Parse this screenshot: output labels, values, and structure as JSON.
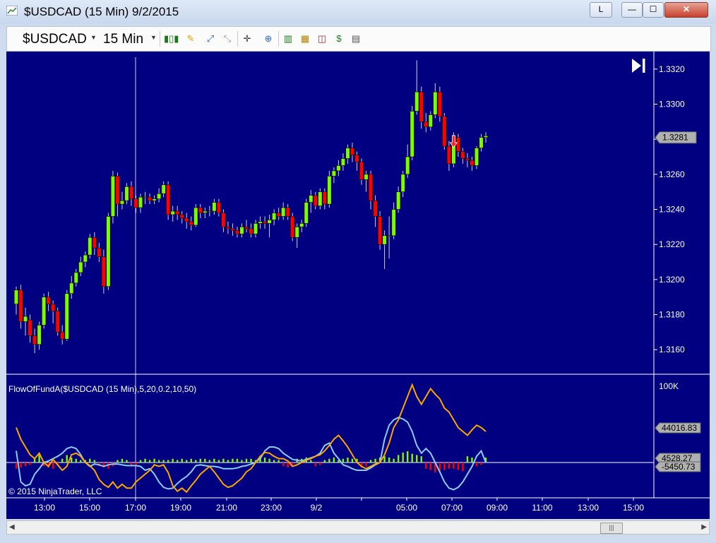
{
  "window": {
    "title": "$USDCAD (15 Min)  9/2/2015",
    "buttons": {
      "link": "L",
      "minimize": "—",
      "maximize": "☐",
      "close": "✕"
    }
  },
  "toolbar": {
    "instrument": "$USDCAD",
    "interval": "15 Min",
    "icons": [
      "bars-icon",
      "pencil-icon",
      "zoom-in-icon",
      "zoom-out-icon",
      "crosshair-icon",
      "zoom-icon",
      "data-box-icon",
      "chart-style-icon",
      "indicators-icon",
      "strategies-icon",
      "properties-icon"
    ]
  },
  "chart_data": {
    "type": "candlestick",
    "colors": {
      "background": "#000080",
      "up": "#7cfc00",
      "down": "#ff0000",
      "axis_text": "#ffffff"
    },
    "price_panel": {
      "y_ticks": [
        "1.3320",
        "1.3300",
        "1.3280",
        "1.3260",
        "1.3240",
        "1.3220",
        "1.3200",
        "1.3180",
        "1.3160"
      ],
      "ylim": [
        1.3146,
        1.333
      ],
      "last_price_label": "1.3281",
      "signal_arrow": {
        "bar": 95,
        "direction": "down"
      },
      "candles": [
        [
          1.3186,
          1.3196,
          1.318,
          1.3194
        ],
        [
          1.3194,
          1.3197,
          1.3172,
          1.3176
        ],
        [
          1.3176,
          1.3184,
          1.3168,
          1.3179
        ],
        [
          1.3177,
          1.318,
          1.3164,
          1.3168
        ],
        [
          1.3168,
          1.3172,
          1.3158,
          1.3163
        ],
        [
          1.3163,
          1.3176,
          1.316,
          1.3174
        ],
        [
          1.3174,
          1.3192,
          1.3172,
          1.319
        ],
        [
          1.319,
          1.3193,
          1.3182,
          1.3186
        ],
        [
          1.3186,
          1.3188,
          1.3175,
          1.3182
        ],
        [
          1.3182,
          1.3184,
          1.3168,
          1.317
        ],
        [
          1.317,
          1.3174,
          1.3163,
          1.3166
        ],
        [
          1.3166,
          1.3194,
          1.3165,
          1.3192
        ],
        [
          1.3192,
          1.3202,
          1.3189,
          1.3198
        ],
        [
          1.3198,
          1.3206,
          1.3196,
          1.3204
        ],
        [
          1.3204,
          1.3213,
          1.3202,
          1.321
        ],
        [
          1.321,
          1.3216,
          1.3207,
          1.3214
        ],
        [
          1.3214,
          1.3226,
          1.3212,
          1.3224
        ],
        [
          1.3224,
          1.3227,
          1.3214,
          1.3218
        ],
        [
          1.3218,
          1.3221,
          1.321,
          1.3213
        ],
        [
          1.3213,
          1.3217,
          1.3192,
          1.3196
        ],
        [
          1.3196,
          1.3238,
          1.3194,
          1.3236
        ],
        [
          1.3236,
          1.3262,
          1.3232,
          1.3259
        ],
        [
          1.3259,
          1.3261,
          1.3236,
          1.3243
        ],
        [
          1.3243,
          1.325,
          1.324,
          1.3245
        ],
        [
          1.3245,
          1.3255,
          1.3243,
          1.3253
        ],
        [
          1.3253,
          1.3256,
          1.3242,
          1.3246
        ],
        [
          1.3246,
          1.3248,
          1.3238,
          1.3241
        ],
        [
          1.3241,
          1.3249,
          1.3238,
          1.3247
        ],
        [
          1.3247,
          1.325,
          1.3243,
          1.3247
        ],
        [
          1.3247,
          1.3249,
          1.3243,
          1.3245
        ],
        [
          1.3245,
          1.3248,
          1.3243,
          1.3246
        ],
        [
          1.3246,
          1.3252,
          1.3244,
          1.3249
        ],
        [
          1.3249,
          1.3256,
          1.3247,
          1.3254
        ],
        [
          1.3254,
          1.3256,
          1.3234,
          1.3237
        ],
        [
          1.3237,
          1.3242,
          1.3233,
          1.3239
        ],
        [
          1.3239,
          1.3242,
          1.3234,
          1.3237
        ],
        [
          1.3237,
          1.3239,
          1.3232,
          1.3235
        ],
        [
          1.3235,
          1.3238,
          1.3229,
          1.3233
        ],
        [
          1.3233,
          1.3236,
          1.3228,
          1.3231
        ],
        [
          1.3231,
          1.3243,
          1.323,
          1.3241
        ],
        [
          1.3241,
          1.3243,
          1.3235,
          1.3238
        ],
        [
          1.3238,
          1.3241,
          1.3235,
          1.3239
        ],
        [
          1.3239,
          1.3242,
          1.3236,
          1.3239
        ],
        [
          1.3239,
          1.3246,
          1.3237,
          1.3244
        ],
        [
          1.3244,
          1.3246,
          1.3236,
          1.3238
        ],
        [
          1.3238,
          1.324,
          1.3227,
          1.323
        ],
        [
          1.323,
          1.3233,
          1.3226,
          1.3229
        ],
        [
          1.3229,
          1.3232,
          1.3225,
          1.3228
        ],
        [
          1.3228,
          1.323,
          1.3224,
          1.3226
        ],
        [
          1.3226,
          1.3232,
          1.3224,
          1.323
        ],
        [
          1.323,
          1.3234,
          1.3227,
          1.3229
        ],
        [
          1.3229,
          1.3232,
          1.3224,
          1.3226
        ],
        [
          1.3226,
          1.3234,
          1.3224,
          1.3232
        ],
        [
          1.3232,
          1.3236,
          1.3229,
          1.3233
        ],
        [
          1.3233,
          1.3236,
          1.3229,
          1.3232
        ],
        [
          1.3232,
          1.3237,
          1.3224,
          1.3234
        ],
        [
          1.3234,
          1.324,
          1.3231,
          1.3238
        ],
        [
          1.3238,
          1.3241,
          1.3234,
          1.3236
        ],
        [
          1.3236,
          1.3244,
          1.3234,
          1.3241
        ],
        [
          1.3241,
          1.3243,
          1.3234,
          1.3236
        ],
        [
          1.3236,
          1.3238,
          1.3222,
          1.3224
        ],
        [
          1.3224,
          1.3232,
          1.3218,
          1.323
        ],
        [
          1.323,
          1.3234,
          1.3227,
          1.3232
        ],
        [
          1.3232,
          1.3246,
          1.323,
          1.3244
        ],
        [
          1.3244,
          1.3251,
          1.3238,
          1.3248
        ],
        [
          1.3248,
          1.325,
          1.324,
          1.3242
        ],
        [
          1.3242,
          1.3252,
          1.324,
          1.325
        ],
        [
          1.325,
          1.3252,
          1.324,
          1.3243
        ],
        [
          1.3243,
          1.3262,
          1.3241,
          1.3259
        ],
        [
          1.3259,
          1.3264,
          1.3255,
          1.3262
        ],
        [
          1.3262,
          1.3268,
          1.3259,
          1.3265
        ],
        [
          1.3265,
          1.3272,
          1.3262,
          1.3269
        ],
        [
          1.3269,
          1.3277,
          1.3266,
          1.3275
        ],
        [
          1.3275,
          1.3278,
          1.3267,
          1.3271
        ],
        [
          1.3271,
          1.3273,
          1.3262,
          1.3267
        ],
        [
          1.3267,
          1.3269,
          1.3254,
          1.3257
        ],
        [
          1.3257,
          1.3262,
          1.325,
          1.326
        ],
        [
          1.326,
          1.3262,
          1.324,
          1.3245
        ],
        [
          1.3245,
          1.3248,
          1.323,
          1.3236
        ],
        [
          1.3236,
          1.3239,
          1.3217,
          1.322
        ],
        [
          1.322,
          1.3228,
          1.3206,
          1.3225
        ],
        [
          1.3225,
          1.3236,
          1.3212,
          1.3225
        ],
        [
          1.3225,
          1.3244,
          1.3223,
          1.324
        ],
        [
          1.324,
          1.3253,
          1.3238,
          1.325
        ],
        [
          1.325,
          1.3262,
          1.3247,
          1.326
        ],
        [
          1.326,
          1.3277,
          1.3258,
          1.327
        ],
        [
          1.327,
          1.3299,
          1.3268,
          1.3296
        ],
        [
          1.3296,
          1.3325,
          1.3294,
          1.3307
        ],
        [
          1.3307,
          1.331,
          1.3286,
          1.329
        ],
        [
          1.329,
          1.3295,
          1.3284,
          1.3287
        ],
        [
          1.3287,
          1.3296,
          1.3285,
          1.3294
        ],
        [
          1.3294,
          1.3312,
          1.3292,
          1.3307
        ],
        [
          1.3307,
          1.331,
          1.329,
          1.3293
        ],
        [
          1.3293,
          1.3295,
          1.3274,
          1.3276
        ],
        [
          1.3276,
          1.3279,
          1.3262,
          1.3266
        ],
        [
          1.3266,
          1.3284,
          1.3264,
          1.3281
        ],
        [
          1.3281,
          1.3283,
          1.327,
          1.3273
        ],
        [
          1.3273,
          1.3275,
          1.3266,
          1.3269
        ],
        [
          1.3269,
          1.3272,
          1.3264,
          1.3268
        ],
        [
          1.3268,
          1.327,
          1.3262,
          1.3265
        ],
        [
          1.3265,
          1.3276,
          1.3263,
          1.3275
        ],
        [
          1.3275,
          1.3283,
          1.3273,
          1.3281
        ],
        [
          1.3281,
          1.3284,
          1.3278,
          1.3282
        ]
      ]
    },
    "indicator_panel": {
      "title": "FlowOfFundA($USDCAD (15 Min),5,20,0.2,10,50)",
      "y_top_label": "100K",
      "value_labels": [
        "44016.83",
        "4528.27",
        "-5450.73"
      ],
      "colors": {
        "fast": "#ffa500",
        "slow": "#87cefa"
      },
      "fast_line": [
        45,
        30,
        20,
        10,
        5,
        12,
        0,
        -5,
        4,
        -3,
        -10,
        -5,
        10,
        12,
        8,
        0,
        -4,
        -10,
        -22,
        -28,
        -32,
        -25,
        -33,
        -28,
        -33,
        -33,
        -25,
        -20,
        -15,
        -10,
        -3,
        -5,
        -3,
        -13,
        -30,
        -37,
        -33,
        -38,
        -30,
        -23,
        -15,
        -10,
        -5,
        -12,
        -20,
        -28,
        -32,
        -30,
        -25,
        -20,
        -12,
        -8,
        0,
        8,
        13,
        12,
        8,
        5,
        5,
        2,
        -5,
        -3,
        0,
        3,
        5,
        8,
        10,
        15,
        22,
        30,
        35,
        28,
        20,
        10,
        0,
        -5,
        -8,
        -5,
        -2,
        0,
        10,
        25,
        45,
        55,
        70,
        85,
        100,
        85,
        75,
        85,
        95,
        88,
        82,
        70,
        65,
        55,
        45,
        40,
        35,
        42,
        48,
        45,
        40
      ],
      "slow_line": [
        15,
        -25,
        -30,
        -28,
        -15,
        -8,
        0,
        2,
        5,
        8,
        12,
        18,
        20,
        18,
        10,
        0,
        -5,
        -2,
        -3,
        -5,
        -3,
        -2,
        -2,
        -3,
        -4,
        -4,
        -4,
        -5,
        -10,
        -8,
        -15,
        -25,
        -32,
        -34,
        -33,
        -27,
        -22,
        -18,
        -12,
        -4,
        -3,
        -4,
        -5,
        -5,
        -6,
        -8,
        -8,
        -8,
        -7,
        -5,
        -4,
        -2,
        0,
        5,
        15,
        20,
        20,
        18,
        12,
        8,
        4,
        3,
        2,
        4,
        6,
        8,
        12,
        22,
        25,
        12,
        5,
        -3,
        -5,
        -8,
        -10,
        -10,
        -10,
        -7,
        -3,
        0,
        30,
        48,
        55,
        58,
        56,
        52,
        40,
        22,
        12,
        18,
        12,
        0,
        -12,
        -25,
        -33,
        -35,
        -32,
        -25,
        -15,
        -5,
        8,
        15,
        0
      ],
      "histogram": [
        -5,
        -4,
        -3,
        -2,
        4,
        6,
        -3,
        -4,
        -5,
        -2,
        3,
        6,
        4,
        3,
        2,
        2,
        3,
        2,
        -3,
        -4,
        -5,
        -3,
        2,
        3,
        2,
        -3,
        -2,
        2,
        3,
        2,
        3,
        2,
        2,
        2,
        3,
        2,
        3,
        2,
        3,
        2,
        3,
        3,
        2,
        3,
        2,
        3,
        2,
        3,
        3,
        2,
        3,
        3,
        2,
        3,
        4,
        3,
        2,
        2,
        -3,
        -4,
        -2,
        3,
        3,
        4,
        2,
        -3,
        -2,
        2,
        3,
        4,
        2,
        3,
        4,
        3,
        3,
        -4,
        -3,
        2,
        3,
        4,
        5,
        4,
        3,
        6,
        8,
        9,
        7,
        6,
        5,
        -5,
        -6,
        -8,
        -7,
        -6,
        -5,
        -5,
        -6,
        -7,
        5,
        4,
        -3,
        -2,
        4
      ]
    },
    "x_ticks": [
      "13:00",
      "15:00",
      "17:00",
      "19:00",
      "21:00",
      "23:00",
      "9/2",
      "05:00",
      "07:00",
      "09:00",
      "11:00",
      "13:00",
      "15:00"
    ],
    "copyright": "© 2015 NinjaTrader, LLC"
  }
}
